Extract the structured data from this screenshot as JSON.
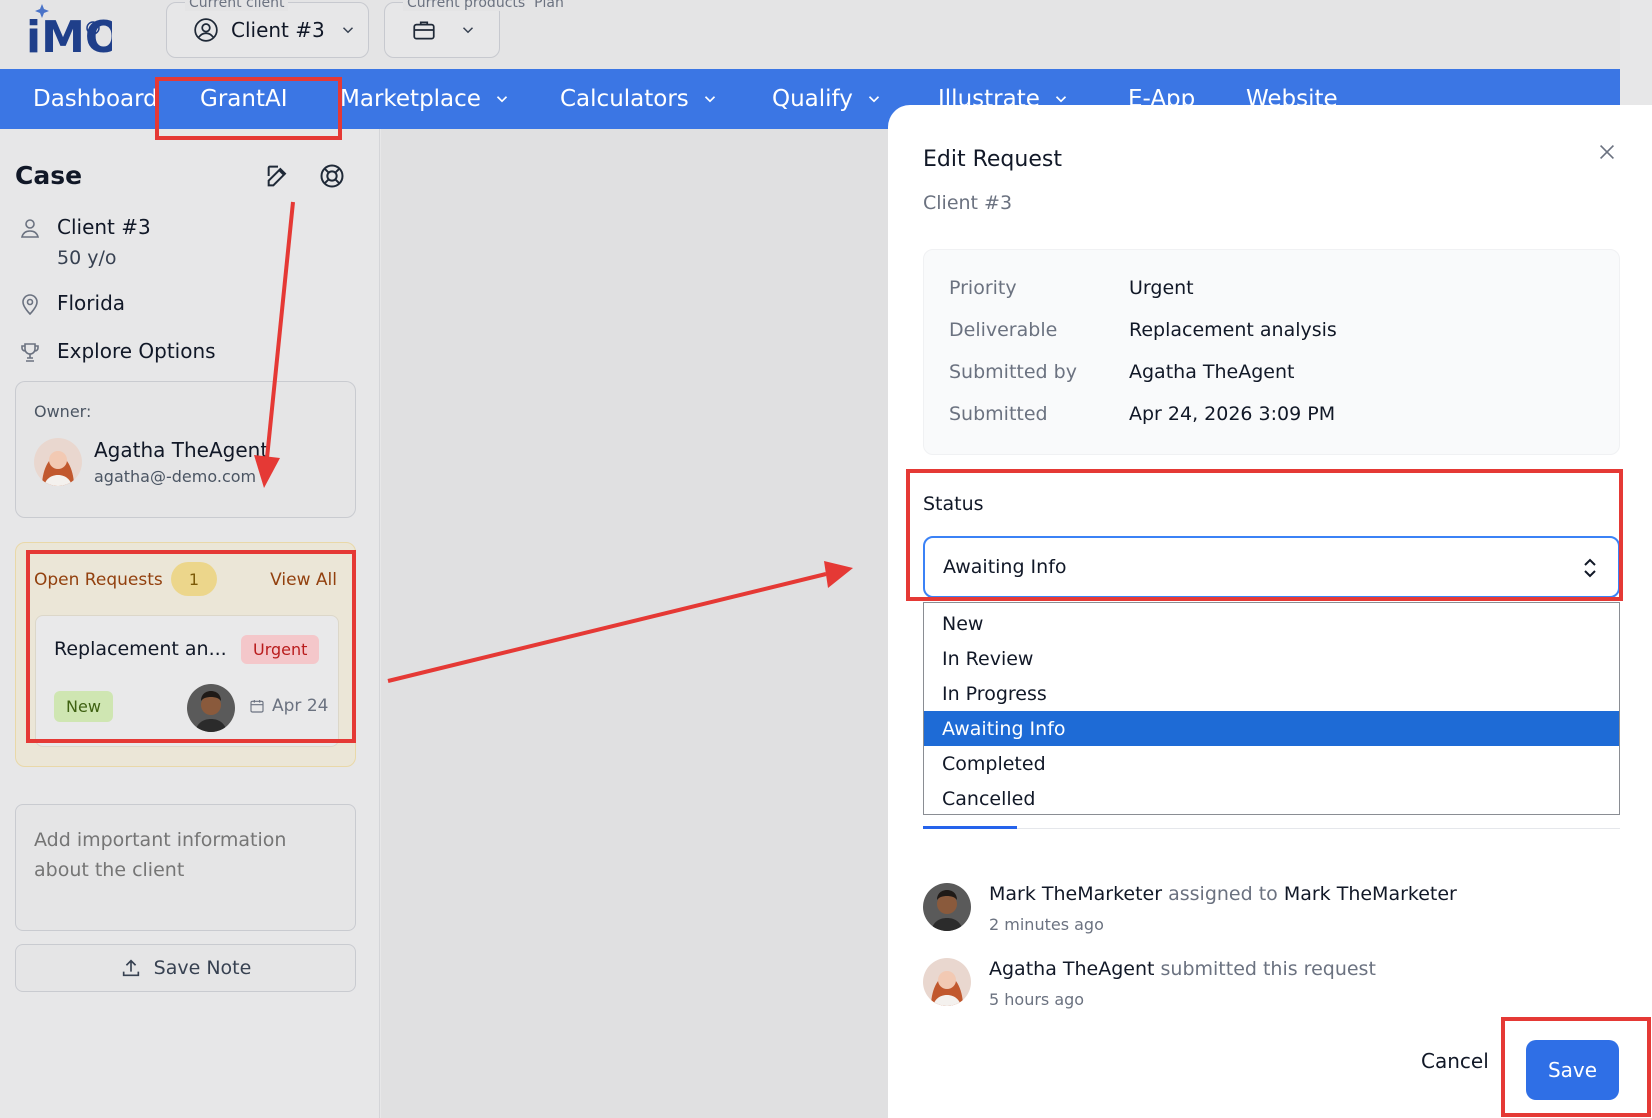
{
  "header": {
    "current_client_label": "Current client",
    "current_client_value": "Client #3",
    "current_products_label": "Current products",
    "plan_label": "Plan"
  },
  "nav": {
    "items": [
      {
        "label": "Dashboard",
        "dropdown": false
      },
      {
        "label": "GrantAI",
        "dropdown": false
      },
      {
        "label": "Marketplace",
        "dropdown": true
      },
      {
        "label": "Calculators",
        "dropdown": true
      },
      {
        "label": "Qualify",
        "dropdown": true
      },
      {
        "label": "Illustrate",
        "dropdown": true
      },
      {
        "label": "E-App",
        "dropdown": false
      },
      {
        "label": "Website",
        "dropdown": false
      }
    ]
  },
  "sidebar": {
    "case_title": "Case",
    "client_name": "Client #3",
    "client_age": "50 y/o",
    "location": "Florida",
    "explore": "Explore Options",
    "owner_label": "Owner:",
    "owner_name": "Agatha TheAgent",
    "owner_email": "agatha@-demo.com",
    "open_requests_title": "Open Requests",
    "open_requests_count": "1",
    "view_all": "View All",
    "request": {
      "name": "Replacement an...",
      "priority_badge": "Urgent",
      "status_badge": "New",
      "date": "Apr 24"
    },
    "note_placeholder": "Add important information about the client",
    "save_note": "Save Note"
  },
  "drawer": {
    "title": "Edit Request",
    "subtitle": "Client #3",
    "details": [
      {
        "key": "Priority",
        "value": "Urgent"
      },
      {
        "key": "Deliverable",
        "value": "Replacement analysis"
      },
      {
        "key": "Submitted by",
        "value": "Agatha TheAgent"
      },
      {
        "key": "Submitted",
        "value": "Apr 24, 2026 3:09 PM"
      }
    ],
    "status_label": "Status",
    "status_value": "Awaiting Info",
    "status_options": [
      "New",
      "In Review",
      "In Progress",
      "Awaiting Info",
      "Completed",
      "Cancelled"
    ],
    "activity": [
      {
        "actor": "Mark TheMarketer",
        "verb": "assigned to",
        "target": "Mark TheMarketer",
        "time": "2 minutes ago"
      },
      {
        "actor": "Agatha TheAgent",
        "verb": "submitted this request",
        "target": "",
        "time": "5 hours ago"
      }
    ],
    "cancel": "Cancel",
    "save": "Save"
  },
  "colors": {
    "nav_blue": "#3b76e4",
    "annotation_red": "#e53935",
    "selected_option": "#1e6bd6",
    "save_button": "#2f6fe6"
  }
}
